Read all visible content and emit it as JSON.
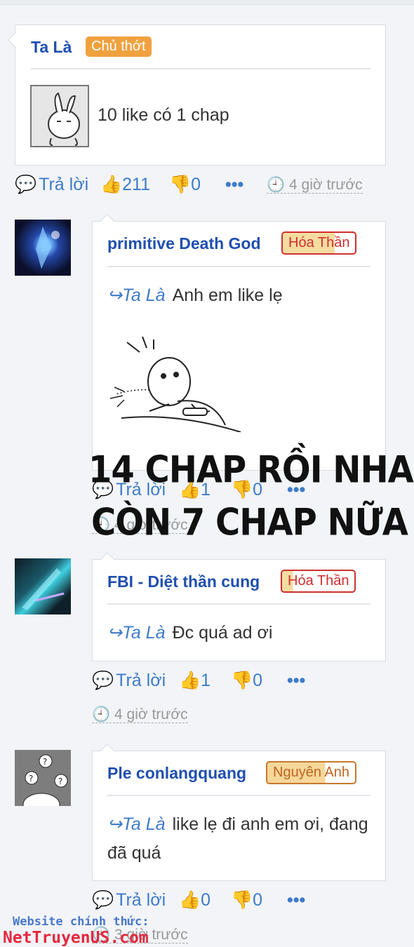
{
  "comments": [
    {
      "user": "Ta Là",
      "badge": "Chủ thớt",
      "text": "10 like có 1 chap",
      "reply_label": "Trả lời",
      "likes": "211",
      "dislikes": "0",
      "time": "4 giờ trước"
    },
    {
      "user": "primitive Death God",
      "badge": "Hóa Thần",
      "reply_to": "Ta Là",
      "text": "Anh em like lẹ",
      "reply_label": "Trả lời",
      "likes": "1",
      "dislikes": "0",
      "time": "4 giờ trước"
    },
    {
      "user": "FBI - Diệt thần cung",
      "badge": "Hóa Thần",
      "reply_to": "Ta Là",
      "text": "Đc quá ad ơi",
      "reply_label": "Trả lời",
      "likes": "1",
      "dislikes": "0",
      "time": "4 giờ trước"
    },
    {
      "user": "Ple conlangquang",
      "badge": "Nguyên Anh",
      "reply_to": "Ta Là",
      "text": "like lẹ đi anh em ơi, đang đã quá",
      "reply_label": "Trả lời",
      "likes": "0",
      "dislikes": "0",
      "time": "3 giờ trước"
    }
  ],
  "overlay": {
    "line1": "14 CHAP RỒI NHA",
    "line2": "CÒN 7 CHAP NỮA"
  },
  "watermark": {
    "label": "Website chính thức:",
    "site": "NetTruyenUS.com"
  },
  "colors": {
    "accent": "#3d7bc9",
    "name": "#1f4fb0",
    "owner_badge": "#f0a13f",
    "rank_border": "#cf2f2f"
  }
}
